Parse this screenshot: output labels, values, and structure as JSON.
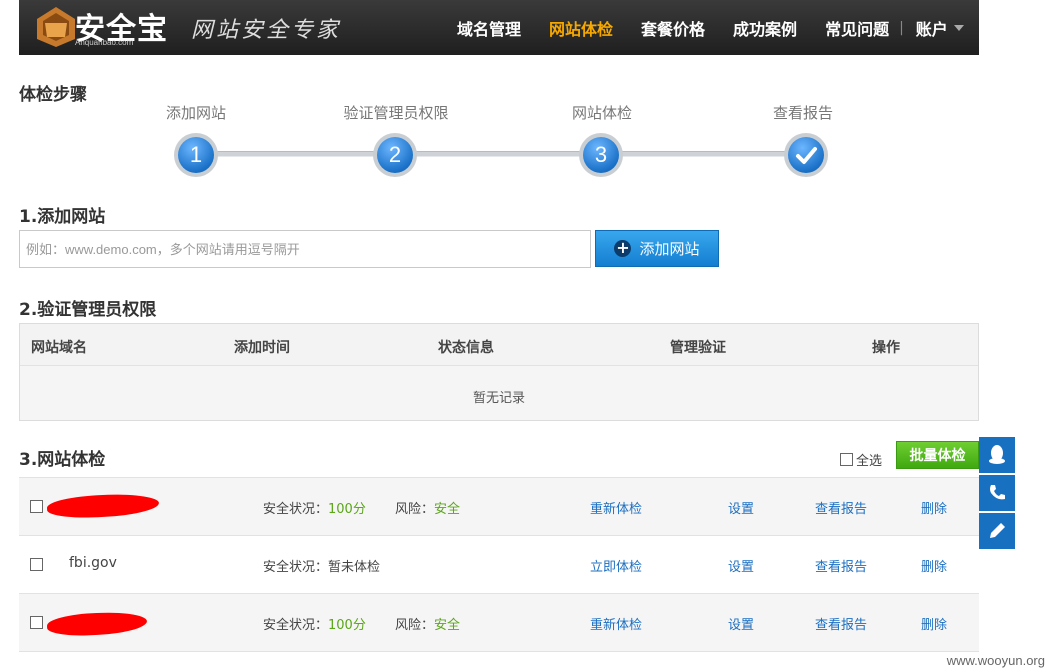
{
  "header": {
    "brand": "安全宝",
    "brand_sub": "Anquanbao.com",
    "slogan": "网站安全专家",
    "nav": [
      "域名管理",
      "网站体检",
      "套餐价格",
      "成功案例",
      "常见问题"
    ],
    "active_nav": "网站体检",
    "separator": "|",
    "account": "账户"
  },
  "steps": {
    "title": "体检步骤",
    "items": [
      {
        "label": "添加网站",
        "marker": "1"
      },
      {
        "label": "验证管理员权限",
        "marker": "2"
      },
      {
        "label": "网站体检",
        "marker": "3"
      },
      {
        "label": "查看报告",
        "marker": "check-icon"
      }
    ]
  },
  "add_site": {
    "title": "1.添加网站",
    "placeholder": "例如：www.demo.com，多个网站请用逗号隔开",
    "button": "添加网站"
  },
  "verify": {
    "title": "2.验证管理员权限",
    "columns": [
      "网站域名",
      "添加时间",
      "状态信息",
      "管理验证",
      "操作"
    ],
    "empty": "暂无记录"
  },
  "checkup": {
    "title": "3.网站体检",
    "select_all": "全选",
    "batch_button": "批量体检",
    "rows": [
      {
        "name": "",
        "redacted": true,
        "status_label": "安全状况：",
        "status_value": "100分",
        "risk_label": "风险：",
        "risk_value": "安全",
        "action": "重新体检",
        "settings": "设置",
        "report": "查看报告",
        "delete": "删除"
      },
      {
        "name": "fbi.gov",
        "redacted": false,
        "status_label": "安全状况：",
        "status_value": "暂未体检",
        "risk_label": "",
        "risk_value": "",
        "action": "立即体检",
        "settings": "设置",
        "report": "查看报告",
        "delete": "删除"
      },
      {
        "name": "",
        "redacted": true,
        "status_label": "安全状况：",
        "status_value": "100分",
        "risk_label": "风险：",
        "risk_value": "安全",
        "action": "重新体检",
        "settings": "设置",
        "report": "查看报告",
        "delete": "删除"
      }
    ]
  },
  "float_buttons": [
    "qq-icon",
    "phone-icon",
    "edit-icon"
  ],
  "watermark": "www.wooyun.org",
  "colors": {
    "brand_blue": "#1870c0",
    "active_nav": "#f6a800",
    "safe_green": "#5ba619",
    "batch_green": "#4cb31a",
    "redaction": "#ff0000"
  }
}
